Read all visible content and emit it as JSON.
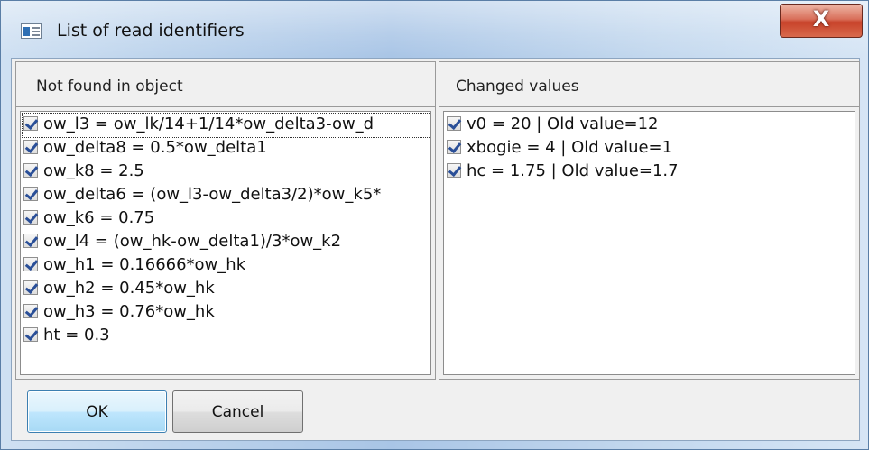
{
  "window": {
    "title": "List of read identifiers",
    "close_label": "X"
  },
  "left_panel": {
    "header": "Not found in object",
    "items": [
      {
        "text": "ow_l3 = ow_lk/14+1/14*ow_delta3-ow_d",
        "checked": true
      },
      {
        "text": "ow_delta8 = 0.5*ow_delta1",
        "checked": true
      },
      {
        "text": "ow_k8 = 2.5",
        "checked": true
      },
      {
        "text": "ow_delta6 = (ow_l3-ow_delta3/2)*ow_k5*",
        "checked": true
      },
      {
        "text": "ow_k6 = 0.75",
        "checked": true
      },
      {
        "text": "ow_l4 = (ow_hk-ow_delta1)/3*ow_k2",
        "checked": true
      },
      {
        "text": "ow_h1 = 0.16666*ow_hk",
        "checked": true
      },
      {
        "text": "ow_h2 = 0.45*ow_hk",
        "checked": true
      },
      {
        "text": "ow_h3 = 0.76*ow_hk",
        "checked": true
      },
      {
        "text": "ht = 0.3",
        "checked": true
      }
    ]
  },
  "right_panel": {
    "header": "Changed values",
    "items": [
      {
        "text": "v0 = 20 | Old value=12",
        "checked": true
      },
      {
        "text": "xbogie = 4 | Old value=1",
        "checked": true
      },
      {
        "text": "hc = 1.75 | Old value=1.7",
        "checked": true
      }
    ]
  },
  "buttons": {
    "ok_label": "OK",
    "cancel_label": "Cancel"
  },
  "colors": {
    "checkmark": "#2a4f98",
    "close_button": "#c8432a",
    "default_button_border": "#3c7fb1"
  }
}
